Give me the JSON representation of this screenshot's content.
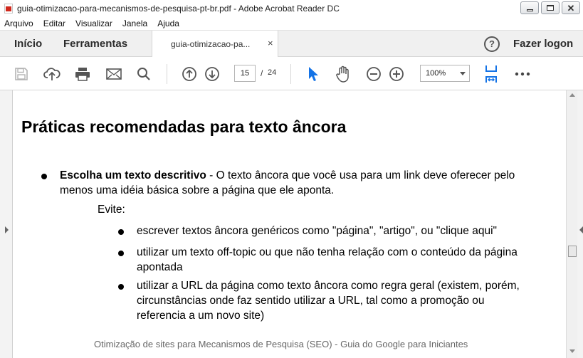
{
  "window": {
    "title": "guia-otimizacao-para-mecanismos-de-pesquisa-pt-br.pdf - Adobe Acrobat Reader DC"
  },
  "menu": {
    "items": [
      "Arquivo",
      "Editar",
      "Visualizar",
      "Janela",
      "Ajuda"
    ]
  },
  "tabs": {
    "home": "Início",
    "tools": "Ferramentas",
    "document": "guia-otimizacao-pa...",
    "close": "×",
    "signin": "Fazer logon",
    "help": "?"
  },
  "toolbar": {
    "current_page": "15",
    "page_separator": "/",
    "total_pages": "24",
    "zoom": "100%",
    "accent_color": "#1473e6",
    "icons": [
      "save-icon",
      "upload-icon",
      "print-icon",
      "mail-icon",
      "search-icon",
      "prev-page-icon",
      "next-page-icon",
      "select-cursor-icon",
      "hand-tool-icon",
      "zoom-out-icon",
      "zoom-in-icon",
      "fit-page-icon",
      "more-icon"
    ]
  },
  "document": {
    "heading": "Práticas recomendadas para texto âncora",
    "main_bullet": {
      "bold": "Escolha um texto descritivo",
      "text_line1": " - O texto âncora que você usa para um link deve oferecer pelo",
      "text_line2": "menos uma idéia básica sobre a página que ele aponta."
    },
    "evite": "Evite:",
    "sub_bullets": [
      {
        "lines": [
          "escrever textos âncora genéricos como \"página\", \"artigo\", ou \"clique aqui\""
        ]
      },
      {
        "lines": [
          "utilizar um texto off-topic ou que não tenha relação com o conteúdo da página",
          "apontada"
        ]
      },
      {
        "lines": [
          "utilizar a URL da página como texto âncora como regra geral (existem, porém,",
          "circunstâncias onde faz sentido utilizar a URL, tal como a promoção ou",
          "referencia a um novo site)"
        ]
      }
    ],
    "footer": "Otimização de sites para Mecanismos de Pesquisa (SEO) - Guia do Google para Iniciantes"
  }
}
